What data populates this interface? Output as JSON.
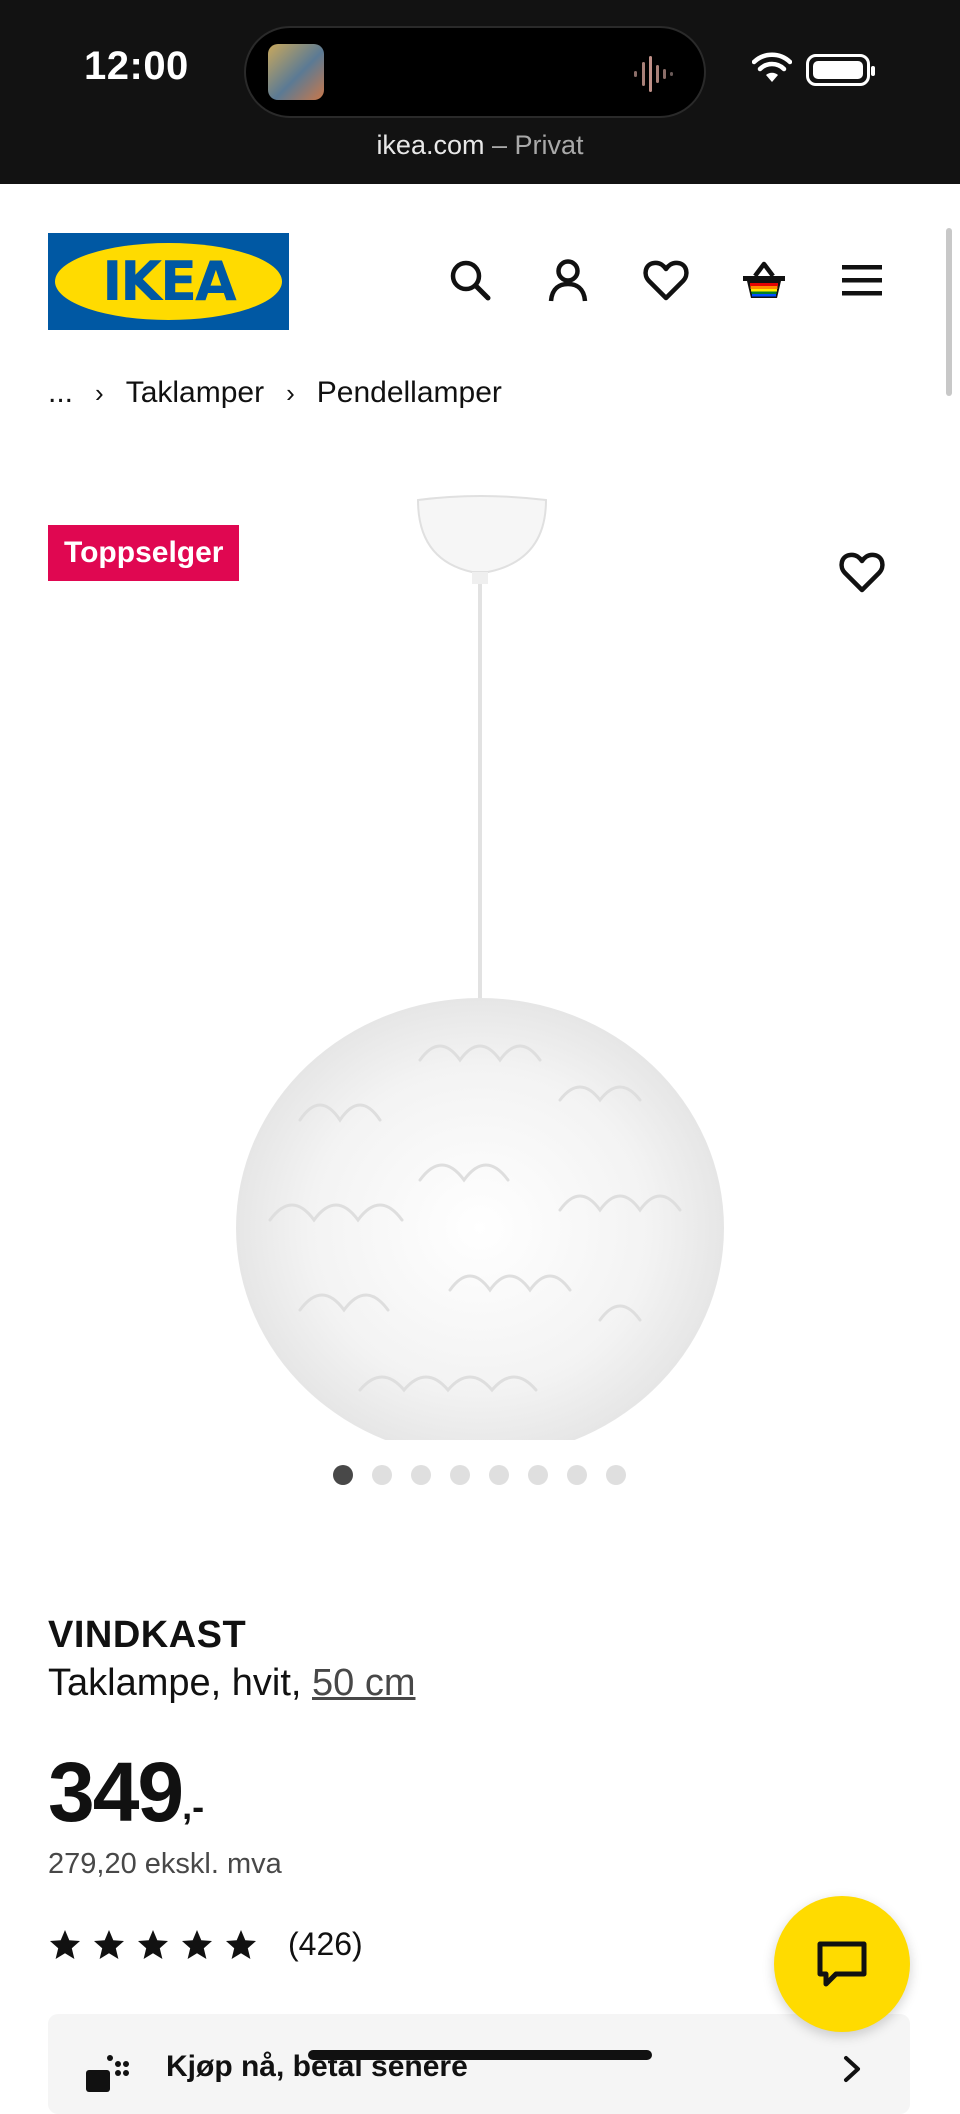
{
  "status_bar": {
    "time": "12:00",
    "url": "ikea.com",
    "mode": "– Privat"
  },
  "header": {
    "logo_text": "IKEA",
    "icons": [
      "search-icon",
      "account-icon",
      "favorites-icon",
      "cart-icon",
      "menu-icon"
    ]
  },
  "breadcrumb": {
    "ellipsis": "...",
    "items": [
      "Taklamper",
      "Pendellamper"
    ]
  },
  "product": {
    "badge": "Toppselger",
    "name": "VINDKAST",
    "description": "Taklampe, hvit, ",
    "size": "50 cm",
    "price": "349",
    "price_suffix": ",-",
    "price_ex_vat": "279,20 ekskl. mva",
    "rating_stars": 5,
    "rating_count": "(426)",
    "image_count": 8,
    "active_image": 1
  },
  "promo": {
    "label": "Kjøp nå, betal senere"
  },
  "colors": {
    "ikea_blue": "#0058a3",
    "ikea_yellow": "#ffdb00",
    "badge": "#e00751"
  }
}
